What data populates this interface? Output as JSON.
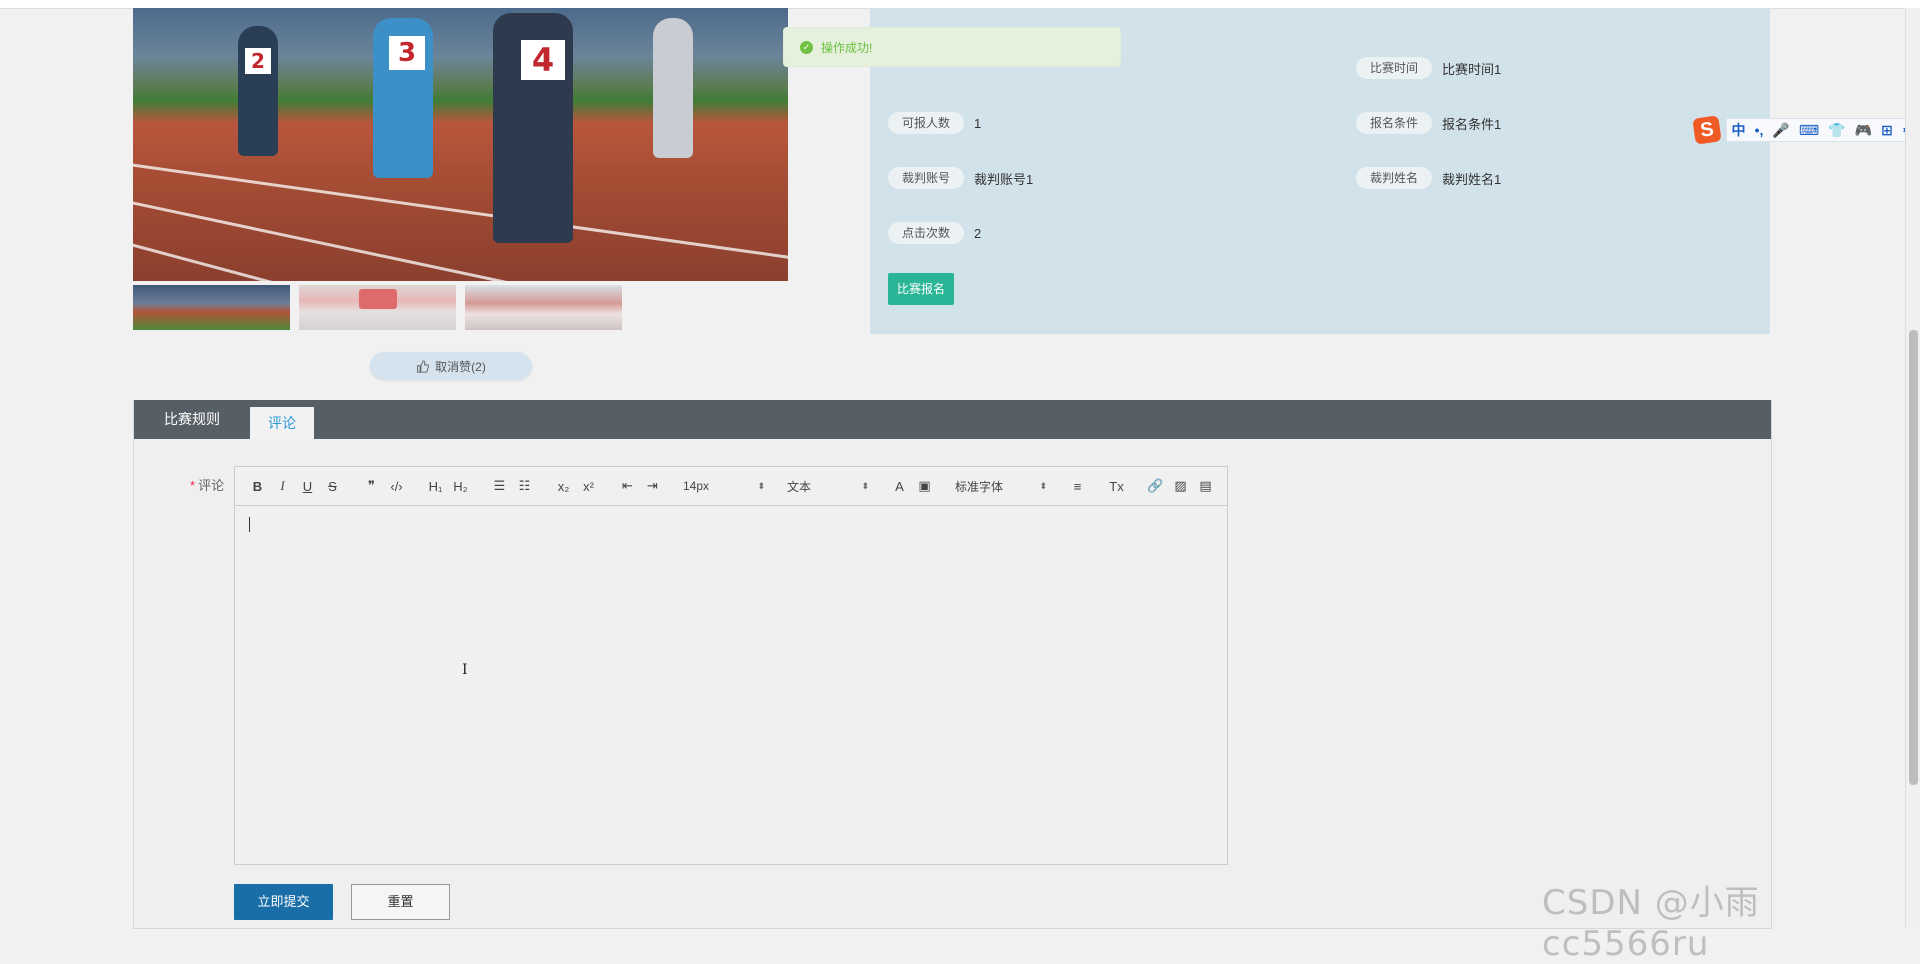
{
  "toast": {
    "message": "操作成功!"
  },
  "info": {
    "rows": [
      {
        "label": "可报人数",
        "value": "1"
      },
      {
        "label": "报名条件",
        "value": "报名条件1"
      },
      {
        "label": "裁判账号",
        "value": "裁判账号1"
      },
      {
        "label": "裁判姓名",
        "value": "裁判姓名1"
      },
      {
        "label": "点击次数",
        "value": "2"
      },
      {
        "label": "比赛时间",
        "value": "比赛时间1"
      }
    ],
    "signup_label": "比赛报名"
  },
  "photo": {
    "bibs": [
      "2",
      "3",
      "4"
    ]
  },
  "like": {
    "label": "取消赞(2)"
  },
  "tabs": [
    {
      "label": "比赛规则",
      "active": false
    },
    {
      "label": "评论",
      "active": true
    }
  ],
  "form": {
    "comment_label": "评论",
    "required_mark": "*",
    "toolbar": {
      "bold": "B",
      "italic": "I",
      "underline": "U",
      "strike": "S",
      "quote": "❞",
      "code": "‹/›",
      "h1": "H₁",
      "h2": "H₂",
      "ordered": "☰",
      "bullet": "☷",
      "sub": "x₂",
      "sup": "x²",
      "outdent": "⇤",
      "indent": "⇥",
      "size": "14px",
      "header": "文本",
      "color": "A",
      "bg": "▣",
      "font": "标准字体",
      "align": "≡",
      "clean": "Tx",
      "link": "🔗",
      "image": "▨",
      "video": "▤"
    },
    "submit_label": "立即提交",
    "reset_label": "重置"
  },
  "ime": {
    "logo": "S",
    "items": [
      "中",
      "•,",
      "🎤",
      "⌨",
      "👕",
      "🎮",
      "⊞",
      "⚙"
    ]
  },
  "watermark": "CSDN @小雨cc5566ru"
}
